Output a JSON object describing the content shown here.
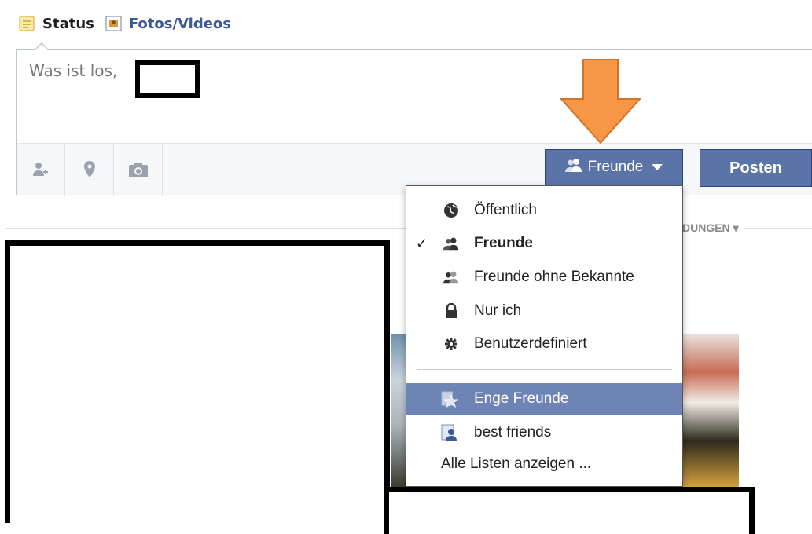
{
  "tabs": [
    {
      "label": "Status",
      "icon": "status-note-icon"
    },
    {
      "label": "Fotos/Videos",
      "icon": "photo-icon"
    }
  ],
  "composer": {
    "placeholder": "Was ist los,",
    "tool_icons": [
      "tag-friends-icon",
      "location-pin-icon",
      "camera-icon"
    ]
  },
  "privacy_button": {
    "label": "Freunde",
    "icon": "friends-icon"
  },
  "post_button": {
    "label": "Posten"
  },
  "feed_sort_label": "DUNGEN",
  "privacy_menu": {
    "audience_options": [
      {
        "label": "Öffentlich",
        "icon": "globe-icon",
        "checked": false
      },
      {
        "label": "Freunde",
        "icon": "friends-icon",
        "checked": true
      },
      {
        "label": "Freunde ohne Bekannte",
        "icon": "friends-except-icon",
        "checked": false
      },
      {
        "label": "Nur ich",
        "icon": "lock-icon",
        "checked": false
      },
      {
        "label": "Benutzerdefiniert",
        "icon": "gear-icon",
        "checked": false
      }
    ],
    "lists": [
      {
        "label": "Enge Freunde",
        "icon": "star-list-icon",
        "highlighted": true
      },
      {
        "label": "best friends",
        "icon": "list-person-icon",
        "highlighted": false
      }
    ],
    "show_all_lists": "Alle Listen anzeigen ..."
  },
  "colors": {
    "fb_blue": "#5b74a8",
    "menu_highlight": "#6d84b4",
    "arrow_orange": "#f79646"
  }
}
